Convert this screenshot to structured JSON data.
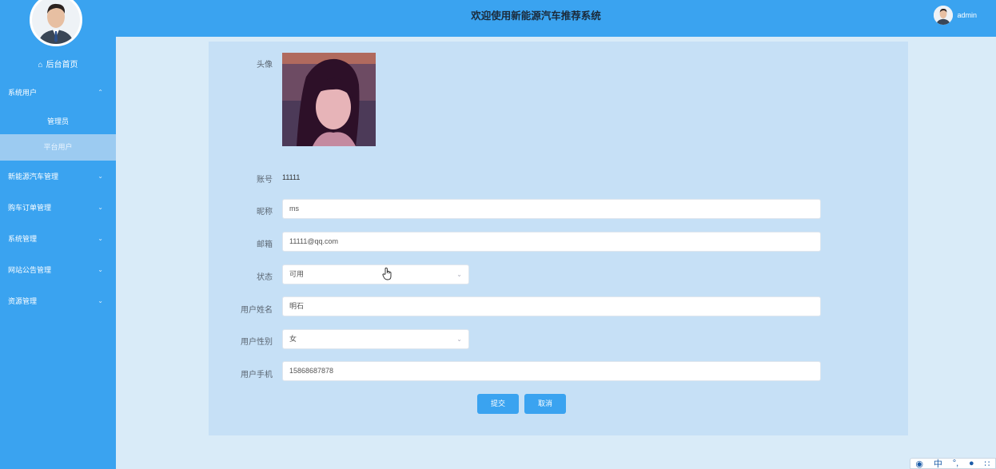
{
  "header": {
    "title": "欢迎使用新能源汽车推荐系统",
    "username": "admin"
  },
  "sidebar": {
    "home_label": "后台首页",
    "menus": [
      {
        "label": "系统用户",
        "expanded": true
      },
      {
        "label": "新能源汽车管理"
      },
      {
        "label": "购车订单管理"
      },
      {
        "label": "系统管理"
      },
      {
        "label": "网站公告管理"
      },
      {
        "label": "资源管理"
      }
    ],
    "sub_items": [
      {
        "label": "管理员"
      },
      {
        "label": "平台用户",
        "active": true
      }
    ]
  },
  "form": {
    "avatar_label": "头像",
    "account_label": "账号",
    "account_value": "11111",
    "nickname_label": "昵称",
    "nickname_value": "ms",
    "email_label": "邮箱",
    "email_value": "11111@qq.com",
    "status_label": "状态",
    "status_value": "可用",
    "realname_label": "用户姓名",
    "realname_value": "明石",
    "gender_label": "用户性别",
    "gender_value": "女",
    "phone_label": "用户手机",
    "phone_value": "15868687878",
    "submit_label": "提交",
    "cancel_label": "取消"
  },
  "ime": {
    "mode": "中"
  },
  "colors": {
    "accent": "#3aa3f0",
    "panel": "#c6e0f6",
    "background": "#d9ebf8"
  }
}
